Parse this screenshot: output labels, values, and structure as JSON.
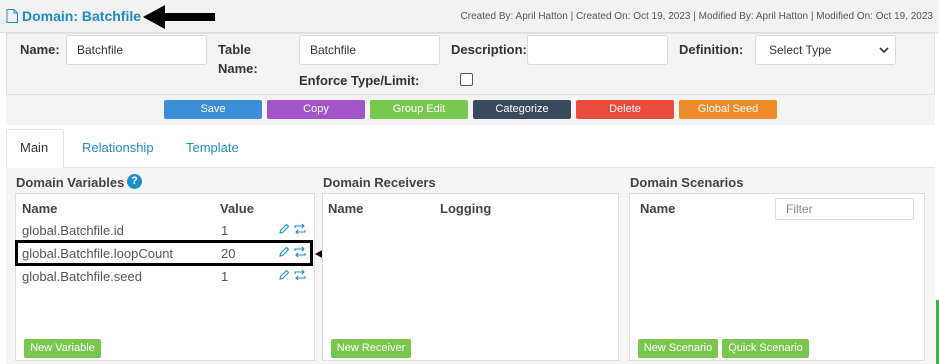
{
  "header": {
    "title": "Domain: Batchfile",
    "meta": "Created By: April Hatton | Created On: Oct 19, 2023 | Modified By: April Hatton | Modified On: Oct 19, 2023"
  },
  "form": {
    "name_label": "Name:",
    "name_value": "Batchfile",
    "table_name_label_1": "Table",
    "table_name_label_2": "Name:",
    "table_name_value": "Batchfile",
    "description_label": "Description:",
    "description_value": "",
    "definition_label": "Definition:",
    "definition_selected": "Select Type",
    "enforce_label": "Enforce Type/Limit:",
    "enforce_checked": false
  },
  "toolbar": {
    "save": "Save",
    "copy": "Copy",
    "group_edit": "Group Edit",
    "categorize": "Categorize",
    "delete": "Delete",
    "global_seed": "Global Seed"
  },
  "tabs": [
    {
      "label": "Main",
      "active": true
    },
    {
      "label": "Relationship",
      "active": false
    },
    {
      "label": "Template",
      "active": false
    }
  ],
  "variables": {
    "title": "Domain Variables",
    "col_name": "Name",
    "col_value": "Value",
    "rows": [
      {
        "name": "global.Batchfile.id",
        "value": "1"
      },
      {
        "name": "global.Batchfile.loopCount",
        "value": "20"
      },
      {
        "name": "global.Batchfile.seed",
        "value": "1"
      }
    ],
    "new_button": "New Variable"
  },
  "receivers": {
    "title": "Domain Receivers",
    "col_name": "Name",
    "col_logging": "Logging",
    "new_button": "New Receiver"
  },
  "scenarios": {
    "title": "Domain Scenarios",
    "col_name": "Name",
    "filter_placeholder": "Filter",
    "new_button": "New Scenario",
    "quick_button": "Quick Scenario"
  },
  "colors": {
    "accent": "#1f8dc7",
    "save": "#3c8fd6",
    "copy": "#a155c9",
    "group_edit": "#7ac74f",
    "categorize": "#3a4a5d",
    "delete": "#e74c3c",
    "global_seed": "#ee8c2c"
  }
}
